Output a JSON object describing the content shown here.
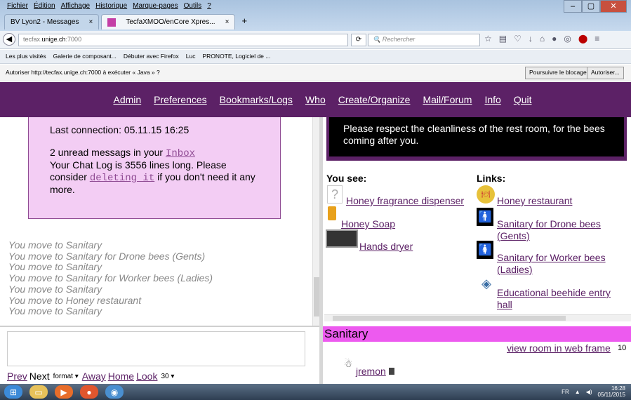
{
  "browser": {
    "menu": [
      "Fichier",
      "Édition",
      "Affichage",
      "Historique",
      "Marque-pages",
      "Outils",
      "?"
    ],
    "tabs": [
      {
        "label": "BV Lyon2 - Messages"
      },
      {
        "label": "TecfaXMOO/enCore Xpres..."
      }
    ],
    "url_prefix": "tecfax.",
    "url_domain": "unige.ch",
    "url_suffix": ":7000",
    "search_placeholder": "Rechercher",
    "bookmarks": [
      "Les plus visités",
      "Galerie de composant...",
      "Débuter avec Firefox",
      "Luc",
      "PRONOTE, Logiciel de ..."
    ],
    "notification": "Autoriser http://tecfax.unige.ch:7000 à exécuter « Java » ?",
    "notif_continue": "Poursuivre le blocage",
    "notif_allow": "Autoriser..."
  },
  "nav": [
    "Admin",
    "Preferences",
    "Bookmarks/Logs",
    "Who",
    "Create/Organize",
    "Mail/Forum",
    "Info",
    "Quit"
  ],
  "info": {
    "last_connection": "Last connection: 05.11.15 16:25",
    "unread_prefix": "2 unread messags in your",
    "inbox": "Inbox",
    "chatlog": "Your Chat Log is 3556 lines long. Please consider",
    "deleting": "deleting it",
    "chatlog_end": "if you don't need it any more."
  },
  "log": [
    "You move to Sanitary",
    "You move to Sanitary for Drone bees (Gents)",
    "You move to Sanitary",
    "You move to Sanitary for Worker bees (Ladies)",
    "You move to Sanitary",
    "You move to Honey restaurant",
    "You move to Sanitary"
  ],
  "room_message": "Please respect the cleanliness of the rest room, for the bees coming after you.",
  "you_see": {
    "title": "You see:",
    "items": [
      "Honey fragrance dispenser",
      "Honey Soap",
      "Hands dryer"
    ]
  },
  "links": {
    "title": "Links:",
    "items": [
      "Honey restaurant",
      "Sanitary for Drone bees (Gents)",
      "Sanitary for Worker bees (Ladies)",
      "Educational beehide entry hall"
    ]
  },
  "room": {
    "title": "Sanitary",
    "web_frame": "view room in web frame",
    "count": "10",
    "user": "jremon"
  },
  "bottom": {
    "prev": "Prev",
    "next": "Next",
    "format": "format",
    "away": "Away",
    "home": "Home",
    "look": "Look",
    "num": "30"
  },
  "tray": {
    "lang": "FR",
    "time": "16:28",
    "date": "05/11/2015"
  }
}
